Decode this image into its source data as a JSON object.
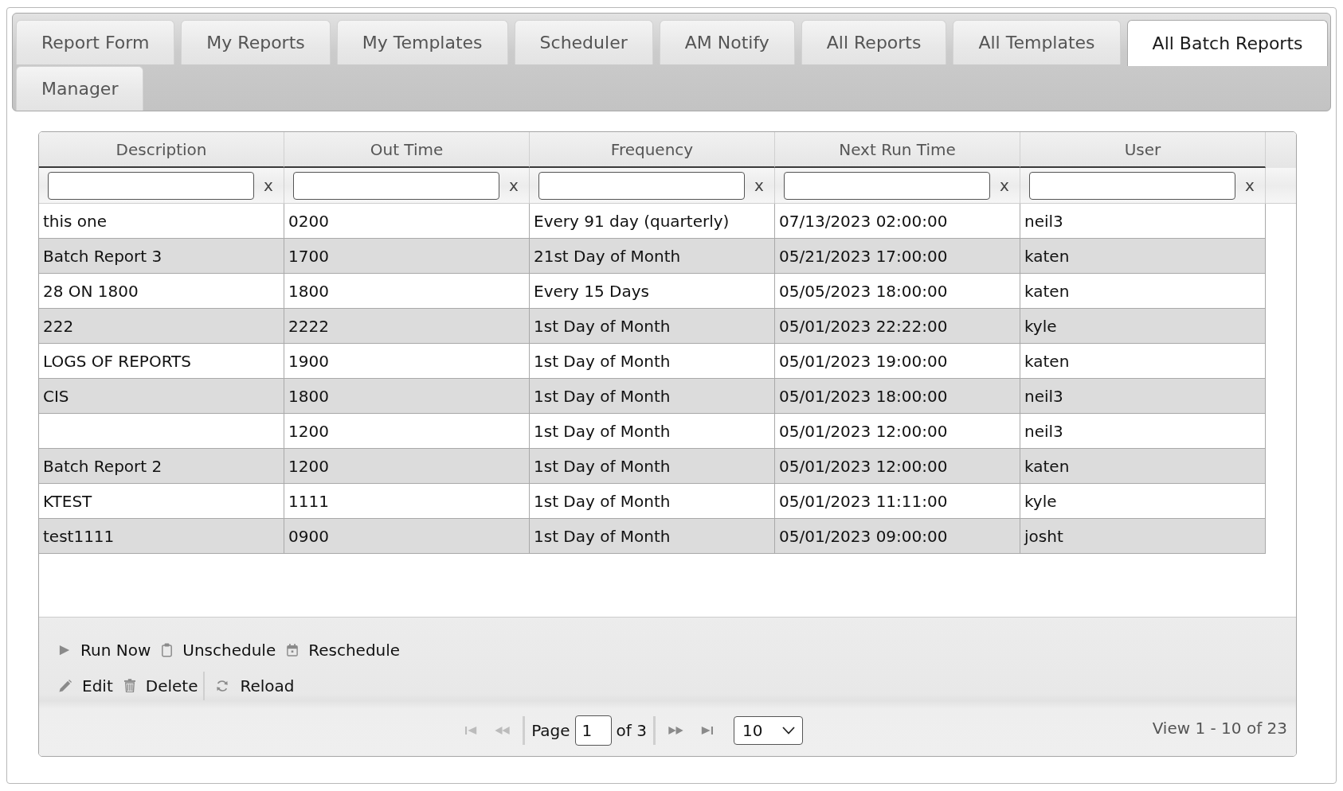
{
  "tab_rows": [
    {
      "tabs": [
        {
          "label": "Report Form",
          "selected": false
        },
        {
          "label": "My Reports",
          "selected": false
        },
        {
          "label": "My Templates",
          "selected": false
        },
        {
          "label": "Scheduler",
          "selected": false
        },
        {
          "label": "AM Notify",
          "selected": false
        },
        {
          "label": "All Reports",
          "selected": false
        },
        {
          "label": "All Templates",
          "selected": false
        },
        {
          "label": "All Batch Reports",
          "selected": true
        }
      ]
    },
    {
      "tabs": [
        {
          "label": "Manager",
          "selected": false
        }
      ]
    }
  ],
  "grid": {
    "columns": [
      "Description",
      "Out Time",
      "Frequency",
      "Next Run Time",
      "User"
    ],
    "filters": [
      {
        "clear": "x"
      },
      {
        "clear": "x"
      },
      {
        "clear": "x"
      },
      {
        "clear": "x"
      },
      {
        "clear": "x"
      }
    ],
    "rows": [
      {
        "description": "this one",
        "out_time": "0200",
        "frequency": "Every 91 day (quarterly)",
        "next_run_time": "07/13/2023 02:00:00",
        "user": "neil3"
      },
      {
        "description": "Batch Report 3",
        "out_time": "1700",
        "frequency": "21st Day of Month",
        "next_run_time": "05/21/2023 17:00:00",
        "user": "katen"
      },
      {
        "description": "28 ON 1800",
        "out_time": "1800",
        "frequency": "Every 15 Days",
        "next_run_time": "05/05/2023 18:00:00",
        "user": "katen"
      },
      {
        "description": "222",
        "out_time": "2222",
        "frequency": "1st Day of Month",
        "next_run_time": "05/01/2023 22:22:00",
        "user": "kyle"
      },
      {
        "description": "LOGS OF REPORTS",
        "out_time": "1900",
        "frequency": "1st Day of Month",
        "next_run_time": "05/01/2023 19:00:00",
        "user": "katen"
      },
      {
        "description": "CIS",
        "out_time": "1800",
        "frequency": "1st Day of Month",
        "next_run_time": "05/01/2023 18:00:00",
        "user": "neil3"
      },
      {
        "out_time": "1200",
        "frequency": "1st Day of Month",
        "next_run_time": "05/01/2023 12:00:00",
        "user": "neil3"
      },
      {
        "description": "Batch Report 2",
        "out_time": "1200",
        "frequency": "1st Day of Month",
        "next_run_time": "05/01/2023 12:00:00",
        "user": "katen"
      },
      {
        "description": "KTEST",
        "out_time": "1111",
        "frequency": "1st Day of Month",
        "next_run_time": "05/01/2023 11:11:00",
        "user": "kyle"
      },
      {
        "description": "test1111",
        "out_time": "0900",
        "frequency": "1st Day of Month",
        "next_run_time": "05/01/2023 09:00:00",
        "user": "josht"
      }
    ]
  },
  "toolbar": {
    "rows": [
      {
        "groups": [
          {
            "buttons": [
              {
                "kind": "run",
                "label": "Run Now"
              },
              {
                "kind": "unschedule",
                "label": "Unschedule"
              },
              {
                "kind": "reschedule",
                "label": "Reschedule"
              }
            ]
          }
        ]
      },
      {
        "groups": [
          {
            "buttons": [
              {
                "kind": "edit",
                "label": "Edit"
              },
              {
                "kind": "delete",
                "label": "Delete"
              }
            ]
          },
          {
            "buttons": [
              {
                "kind": "reload",
                "label": "Reload"
              }
            ]
          }
        ]
      }
    ]
  },
  "pager": {
    "nav_buttons": [
      {
        "kind": "first",
        "disabled": true
      },
      {
        "kind": "prev",
        "disabled": true
      },
      {
        "kind": "next",
        "disabled": false
      },
      {
        "kind": "last",
        "disabled": false
      }
    ],
    "page_label": "Page",
    "page": "1",
    "total_label": "of 3",
    "rows_per_page": "10",
    "summary": "View 1 - 10 of 23"
  }
}
